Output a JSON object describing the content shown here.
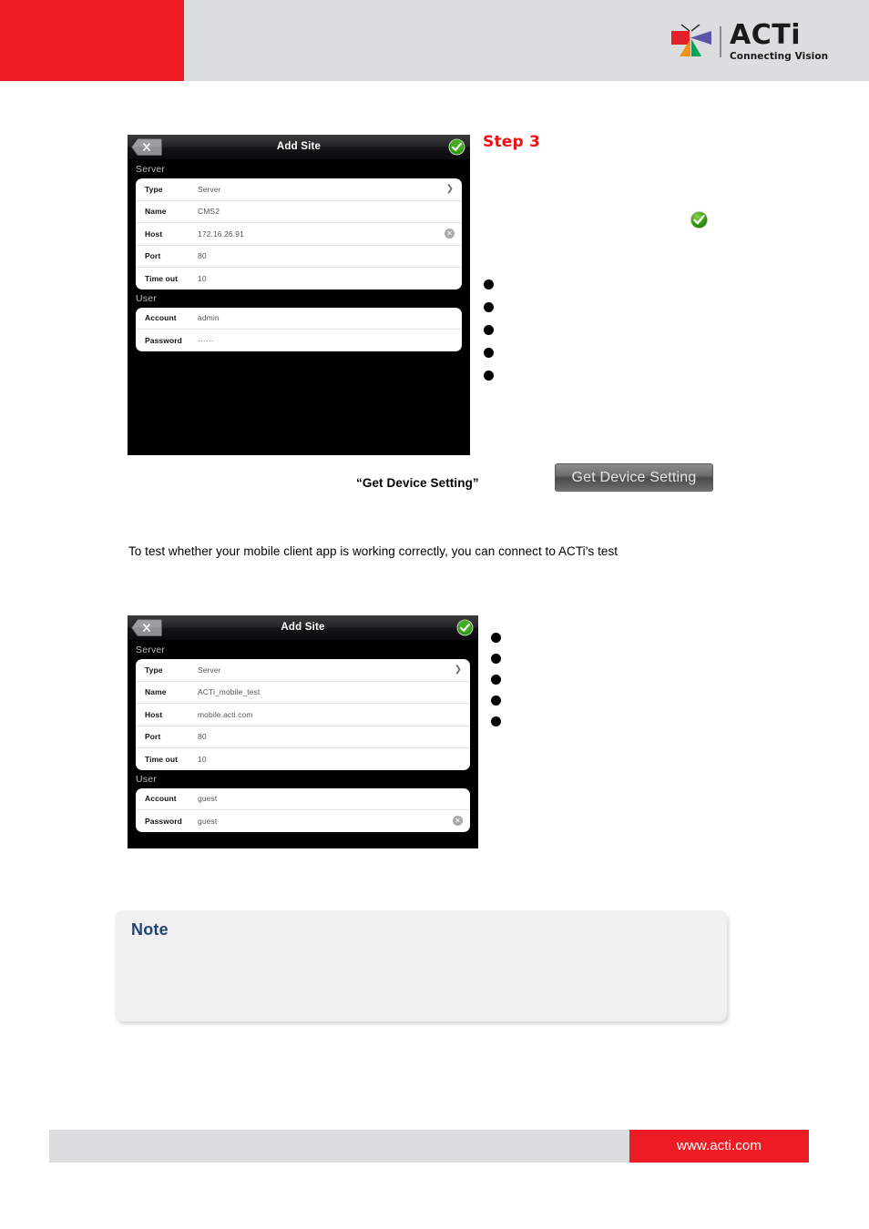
{
  "header": {
    "brand_wordmark": "ACTi",
    "brand_tagline": "Connecting Vision",
    "accent_red": "#ed1c24",
    "band_gray": "#dcdddf",
    "logo_icon": "acti-butterfly-logo-icon",
    "logo_colors": {
      "red": "#e32028",
      "purple": "#5b55a8",
      "orange": "#f29219",
      "green": "#00a357"
    }
  },
  "step": {
    "label": "Step 3",
    "color": "#ee1111"
  },
  "inline_icons": {
    "confirm_check": "green-check-circle-icon"
  },
  "screenshot_one": {
    "titlebar": {
      "back_icon": "back-close-x-icon",
      "title": "Add Site",
      "confirm_icon": "green-check-circle-icon"
    },
    "sections": [
      {
        "heading": "Server",
        "rows": [
          {
            "label": "Type",
            "value": "Server",
            "accessory": "chevron-right-icon"
          },
          {
            "label": "Name",
            "value": "CMS2",
            "accessory": ""
          },
          {
            "label": "Host",
            "value": "172.16.26.91",
            "accessory": "clear-x-icon"
          },
          {
            "label": "Port",
            "value": "80",
            "accessory": ""
          },
          {
            "label": "Time out",
            "value": "10",
            "accessory": ""
          }
        ]
      },
      {
        "heading": "User",
        "rows": [
          {
            "label": "Account",
            "value": "admin",
            "accessory": ""
          },
          {
            "label": "Password",
            "value": "······",
            "accessory": ""
          }
        ]
      }
    ]
  },
  "screenshot_two": {
    "titlebar": {
      "back_icon": "back-close-x-icon",
      "title": "Add Site",
      "confirm_icon": "green-check-circle-icon"
    },
    "sections": [
      {
        "heading": "Server",
        "rows": [
          {
            "label": "Type",
            "value": "Server",
            "accessory": "chevron-right-icon"
          },
          {
            "label": "Name",
            "value": "ACTi_mobile_test",
            "accessory": ""
          },
          {
            "label": "Host",
            "value": "mobile.acti.com",
            "accessory": ""
          },
          {
            "label": "Port",
            "value": "80",
            "accessory": ""
          },
          {
            "label": "Time out",
            "value": "10",
            "accessory": ""
          }
        ]
      },
      {
        "heading": "User",
        "rows": [
          {
            "label": "Account",
            "value": "guest",
            "accessory": ""
          },
          {
            "label": "Password",
            "value": "guest",
            "accessory": "clear-x-icon"
          }
        ]
      }
    ]
  },
  "bullet_list_one": {
    "count": 5
  },
  "bullet_list_two": {
    "count": 5
  },
  "get_device_setting": {
    "quoted_label": "“Get Device Setting”",
    "button_label": "Get Device Setting"
  },
  "body": {
    "paragraph": "To test whether your mobile client app is working correctly, you can connect to ACTi’s test"
  },
  "note": {
    "title": "Note",
    "title_color": "#1f4377",
    "body": ""
  },
  "footer": {
    "url": "www.acti.com",
    "bar_color": "#dcdddf",
    "url_block_color": "#ed1c24"
  }
}
